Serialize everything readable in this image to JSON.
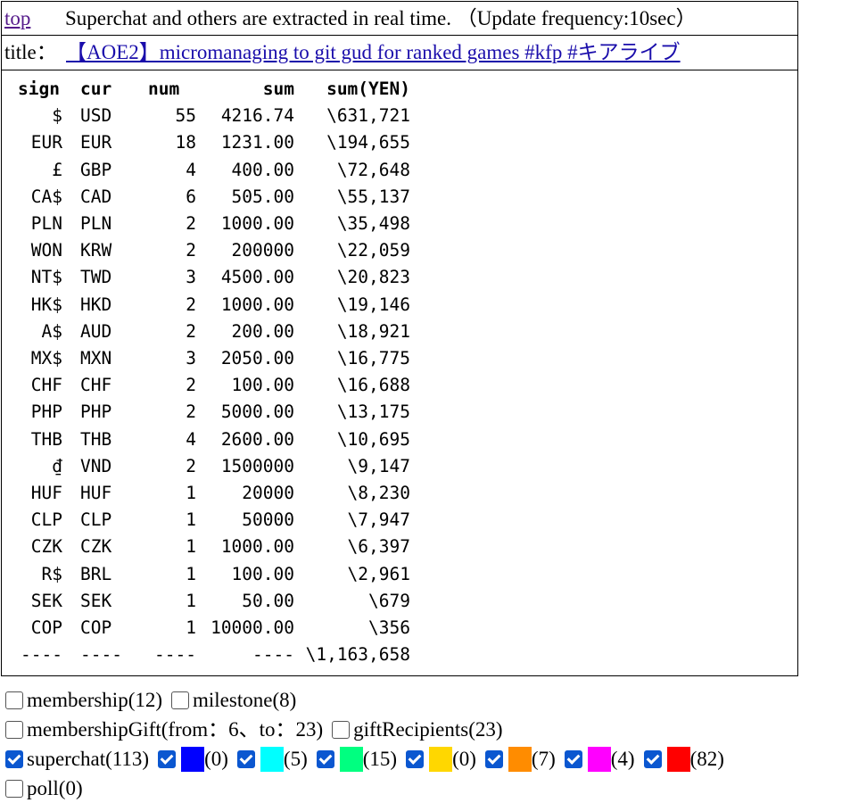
{
  "header": {
    "top_link": "top",
    "info": "Superchat and others are extracted in real time. （Update frequency:10sec）"
  },
  "title_row": {
    "label": "title：",
    "video_title": "【AOE2】micromanaging to git gud for ranked games #kfp #キアライブ"
  },
  "table": {
    "headers": [
      "sign",
      "cur",
      "num",
      "sum",
      "sum(YEN)"
    ],
    "rows": [
      [
        "$",
        "USD",
        "55",
        "4216.74",
        "\\631,721"
      ],
      [
        "EUR",
        "EUR",
        "18",
        "1231.00",
        "\\194,655"
      ],
      [
        "£",
        "GBP",
        "4",
        "400.00",
        "\\72,648"
      ],
      [
        "CA$",
        "CAD",
        "6",
        "505.00",
        "\\55,137"
      ],
      [
        "PLN",
        "PLN",
        "2",
        "1000.00",
        "\\35,498"
      ],
      [
        "WON",
        "KRW",
        "2",
        "200000",
        "\\22,059"
      ],
      [
        "NT$",
        "TWD",
        "3",
        "4500.00",
        "\\20,823"
      ],
      [
        "HK$",
        "HKD",
        "2",
        "1000.00",
        "\\19,146"
      ],
      [
        "A$",
        "AUD",
        "2",
        "200.00",
        "\\18,921"
      ],
      [
        "MX$",
        "MXN",
        "3",
        "2050.00",
        "\\16,775"
      ],
      [
        "CHF",
        "CHF",
        "2",
        "100.00",
        "\\16,688"
      ],
      [
        "PHP",
        "PHP",
        "2",
        "5000.00",
        "\\13,175"
      ],
      [
        "THB",
        "THB",
        "4",
        "2600.00",
        "\\10,695"
      ],
      [
        "₫",
        "VND",
        "2",
        "1500000",
        "\\9,147"
      ],
      [
        "HUF",
        "HUF",
        "1",
        "20000",
        "\\8,230"
      ],
      [
        "CLP",
        "CLP",
        "1",
        "50000",
        "\\7,947"
      ],
      [
        "CZK",
        "CZK",
        "1",
        "1000.00",
        "\\6,397"
      ],
      [
        "R$",
        "BRL",
        "1",
        "100.00",
        "\\2,961"
      ],
      [
        "SEK",
        "SEK",
        "1",
        "50.00",
        "\\679"
      ],
      [
        "COP",
        "COP",
        "1",
        "10000.00",
        "\\356"
      ]
    ],
    "footer": [
      "----",
      "----",
      "----",
      "----",
      "\\1,163,658"
    ]
  },
  "filters": {
    "membership": "membership(12)",
    "milestone": "milestone(8)",
    "membership_gift": "membershipGift(from：6、to：23)",
    "gift_recipients": "giftRecipients(23)",
    "superchat": "superchat(113)",
    "tiers": [
      {
        "color": "#0000ff",
        "count": "(0)"
      },
      {
        "color": "#00ffff",
        "count": "(5)"
      },
      {
        "color": "#00ff80",
        "count": "(15)"
      },
      {
        "color": "#ffd700",
        "count": "(0)"
      },
      {
        "color": "#ff8c00",
        "count": "(7)"
      },
      {
        "color": "#ff00ff",
        "count": "(4)"
      },
      {
        "color": "#ff0000",
        "count": "(82)"
      }
    ],
    "poll": "poll(0)"
  }
}
